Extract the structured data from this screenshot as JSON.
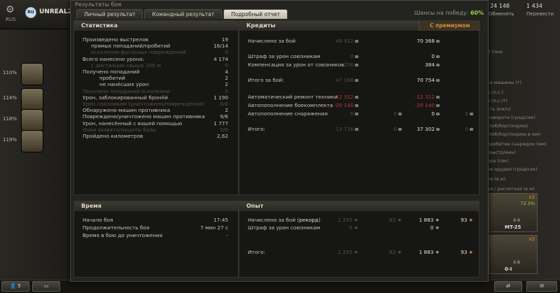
{
  "garage": {
    "region_label": "RUS",
    "clan_tag": "RU",
    "player_name": "UNREAL27[",
    "crew_percentages": [
      "110%",
      "114%",
      "118%",
      "119%"
    ],
    "right_panel": {
      "credits_top": "24 148",
      "credits_label": "Обменять",
      "gold_top": "1 434",
      "gold_label": "Перевести",
      "lines": [
        "й танк",
        "са машины (т)",
        "а (л.с.)",
        "а (л.с./т)",
        "сть (км/ч)",
        "поворота (град/сек)",
        "(лоб/борт/корма)",
        "(лоб/борт/корма в мм)",
        "пробитие снарядом (мм)",
        "(выстр/мин)",
        "ора (сек)",
        "ие орудия (град/сек)",
        "ие (в м)",
        "ая / расчетная (в м)"
      ],
      "tanks": [
        {
          "tier": "X-9",
          "name": "MT-25",
          "x": "x2",
          "pct": "72.3%"
        },
        {
          "tier": "X-8",
          "name": "0-I",
          "x": "x2"
        }
      ]
    },
    "bottom_left_count": "5"
  },
  "dialog": {
    "title": "Результаты боя",
    "tabs": [
      "Личный результат",
      "Командный результат",
      "Подробный отчет"
    ],
    "win_chance_label": "Шансы на победу:",
    "win_chance_value": "60%",
    "stats": {
      "header": "Статистика",
      "rows": [
        {
          "label": "Произведено выстрелов",
          "value": "19",
          "indent": 0
        },
        {
          "label": "прямых попаданий/пробитий",
          "value": "16/14",
          "indent": 1
        },
        {
          "label": "осколочно-фугасных повреждений",
          "value": "0",
          "indent": 1,
          "dim": true
        },
        {
          "label": "Всего нанесено урона:",
          "value": "4 174",
          "indent": 0
        },
        {
          "label": "с дистанции свыше 300 м",
          "value": "0",
          "indent": 1,
          "dim": true
        },
        {
          "label": "Получено попаданий",
          "value": "4",
          "indent": 0
        },
        {
          "label": "пробитий",
          "value": "2",
          "indent": 2
        },
        {
          "label": "не нанёсших урон",
          "value": "2",
          "indent": 2
        },
        {
          "label": "Получено попаданий осколками",
          "value": "0",
          "indent": 0,
          "dim": true
        },
        {
          "label": "Урон, заблокированный бронёй",
          "value": "1 190",
          "indent": 0
        },
        {
          "label": "Урон союзникам (уничтожено/повреждений)",
          "value": "0/0",
          "indent": 0,
          "dim": true
        },
        {
          "label": "Обнаружено машин противника",
          "value": "2",
          "indent": 0
        },
        {
          "label": "Повреждено/уничтожено машин противника",
          "value": "9/6",
          "indent": 0
        },
        {
          "label": "Урон, нанесённый с вашей помощью",
          "value": "1 777",
          "indent": 0
        },
        {
          "label": "Очки захвата/защиты базы",
          "value": "0/0",
          "indent": 0,
          "dim": true
        },
        {
          "label": "Пройдено километров",
          "value": "2,62",
          "indent": 0
        }
      ]
    },
    "credits": {
      "header": "Кредиты",
      "premium_label": "С премиумом",
      "rows": [
        {
          "label": "Начислено за бой",
          "base": "46 912",
          "prem": "70 368"
        },
        {
          "label": "Штраф за урон союзникам",
          "base": "0",
          "prem": "0"
        },
        {
          "label": "Компенсация за урон от союзников",
          "base": "256",
          "prem": "384"
        },
        {
          "label": "Итого за бой:",
          "base": "47 168",
          "prem": "70 754"
        },
        {
          "label": "Автоматический ремонт техники",
          "base": "-12 312",
          "prem": "-12 312"
        },
        {
          "label": "Автопополнение боекомплекта",
          "base": "-20 140",
          "prem": "-20 140"
        },
        {
          "label": "Автопополнение снаряжения",
          "base": "0",
          "base2": "0",
          "prem": "0",
          "prem2": "0"
        },
        {
          "label": "Итого:",
          "base": "13 716",
          "base2": "0",
          "prem": "37 302",
          "prem2": "0"
        }
      ]
    },
    "time": {
      "header": "Время",
      "rows": [
        {
          "label": "Начало боя",
          "value": "17:45"
        },
        {
          "label": "Продолжительность боя",
          "value": "7 мин 27 с"
        },
        {
          "label": "Время в бою до уничтожения",
          "value": "-"
        }
      ]
    },
    "exp": {
      "header": "Опыт",
      "rows": [
        {
          "label_a": "Начислено за бой (",
          "label_b": "рекорд",
          "label_c": ")",
          "base": "1 255",
          "base2": "62",
          "prem": "1 883",
          "prem2": "93"
        },
        {
          "label_a": "Штраф за урон союзникам",
          "label_b": "",
          "label_c": "",
          "base": "0",
          "base2": "",
          "prem": "0",
          "prem2": ""
        },
        {
          "label_a": "Итого:",
          "label_b": "",
          "label_c": "",
          "base": "1 255",
          "base2": "62",
          "prem": "1 883",
          "prem2": "93"
        }
      ]
    }
  }
}
